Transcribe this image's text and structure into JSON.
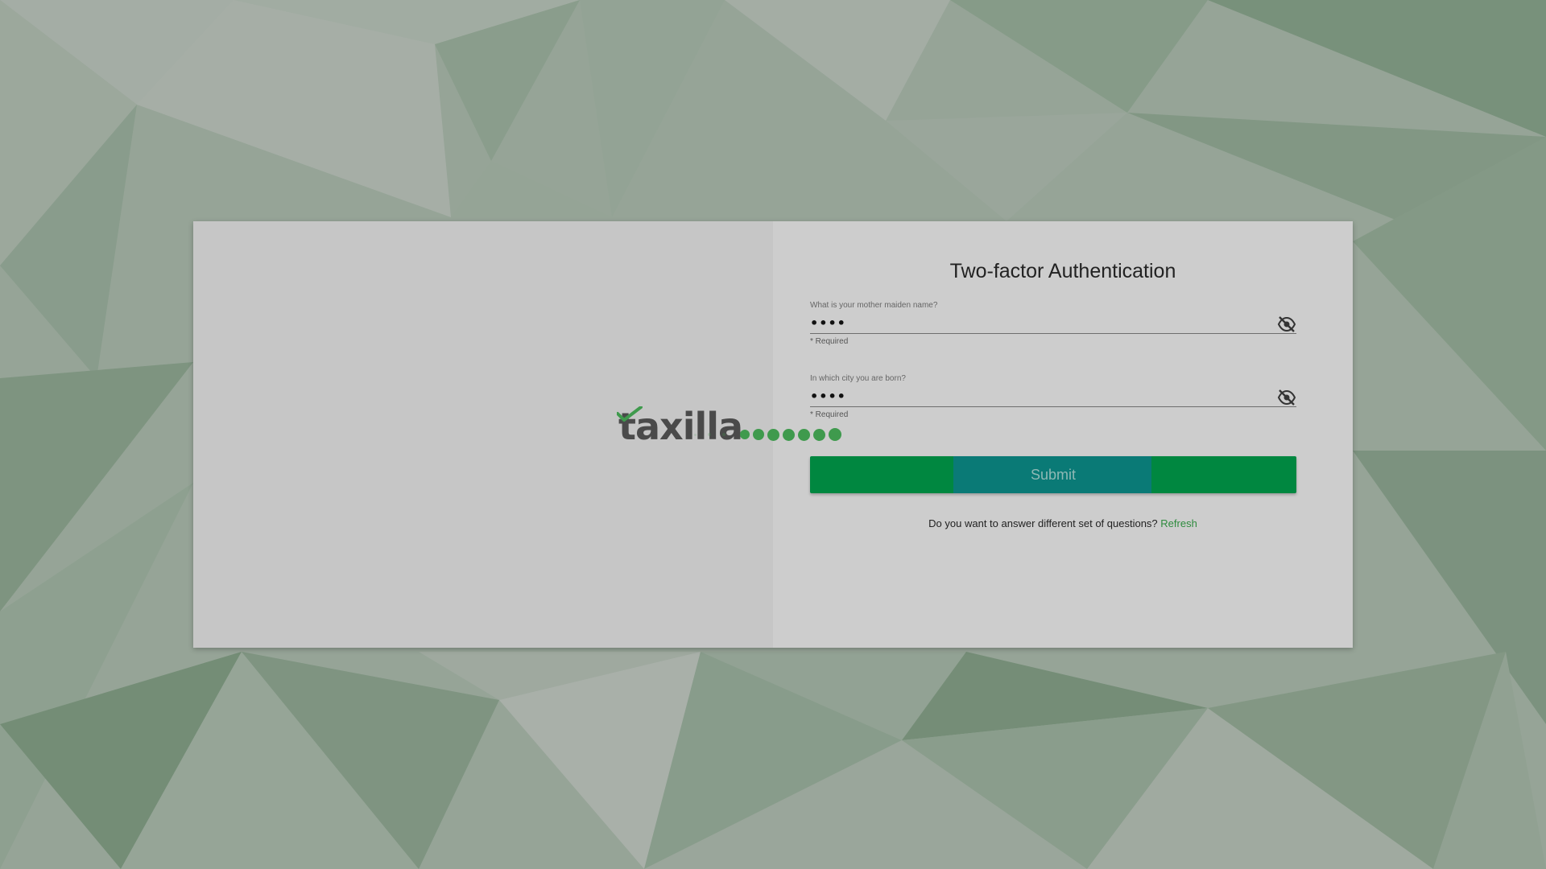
{
  "brand": {
    "logo_text": "taxilla",
    "accent_color": "#008740"
  },
  "form": {
    "title": "Two-factor Authentication",
    "fields": [
      {
        "label": "What is your mother maiden name?",
        "value": "••••",
        "help": "* Required",
        "toggle_icon": "eye-off-icon"
      },
      {
        "label": "In which city you are born?",
        "value": "••••",
        "help": "* Required",
        "toggle_icon": "eye-off-icon"
      }
    ],
    "submit_label": "Submit",
    "refresh_prompt": "Do you want to answer different set of questions?",
    "refresh_link": "Refresh"
  },
  "loading": {
    "icon": "loading-dots-icon",
    "color": "#3f9a4d"
  }
}
